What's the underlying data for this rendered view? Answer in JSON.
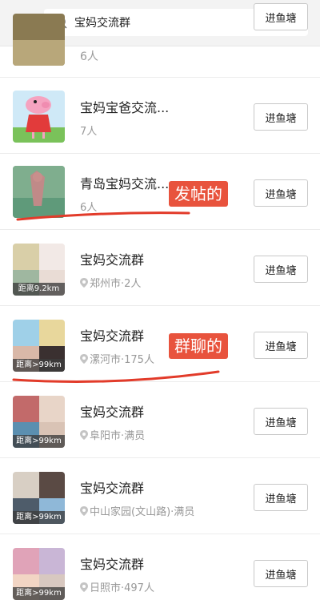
{
  "search": {
    "value": "宝妈交流群",
    "placeholder": ""
  },
  "join_label": "进鱼塘",
  "rows": [
    {
      "name": "",
      "meta": "6人",
      "distance": ""
    },
    {
      "name": "宝妈宝爸交流...",
      "meta": "7人",
      "distance": ""
    },
    {
      "name": "青岛宝妈交流...",
      "meta": "6人",
      "distance": ""
    },
    {
      "name": "宝妈交流群",
      "meta": "郑州市·2人",
      "distance": "距离9.2km"
    },
    {
      "name": "宝妈交流群",
      "meta": "漯河市·175人",
      "distance": "距离>99km"
    },
    {
      "name": "宝妈交流群",
      "meta": "阜阳市·满员",
      "distance": "距离>99km"
    },
    {
      "name": "宝妈交流群",
      "meta": "中山家园(文山路)·满员",
      "distance": "距离>99km"
    },
    {
      "name": "宝妈交流群",
      "meta": "日照市·497人",
      "distance": "距离>99km"
    }
  ],
  "annotations": {
    "post_label": "发帖的",
    "group_chat_label": "群聊的",
    "color": "#e8533d"
  }
}
